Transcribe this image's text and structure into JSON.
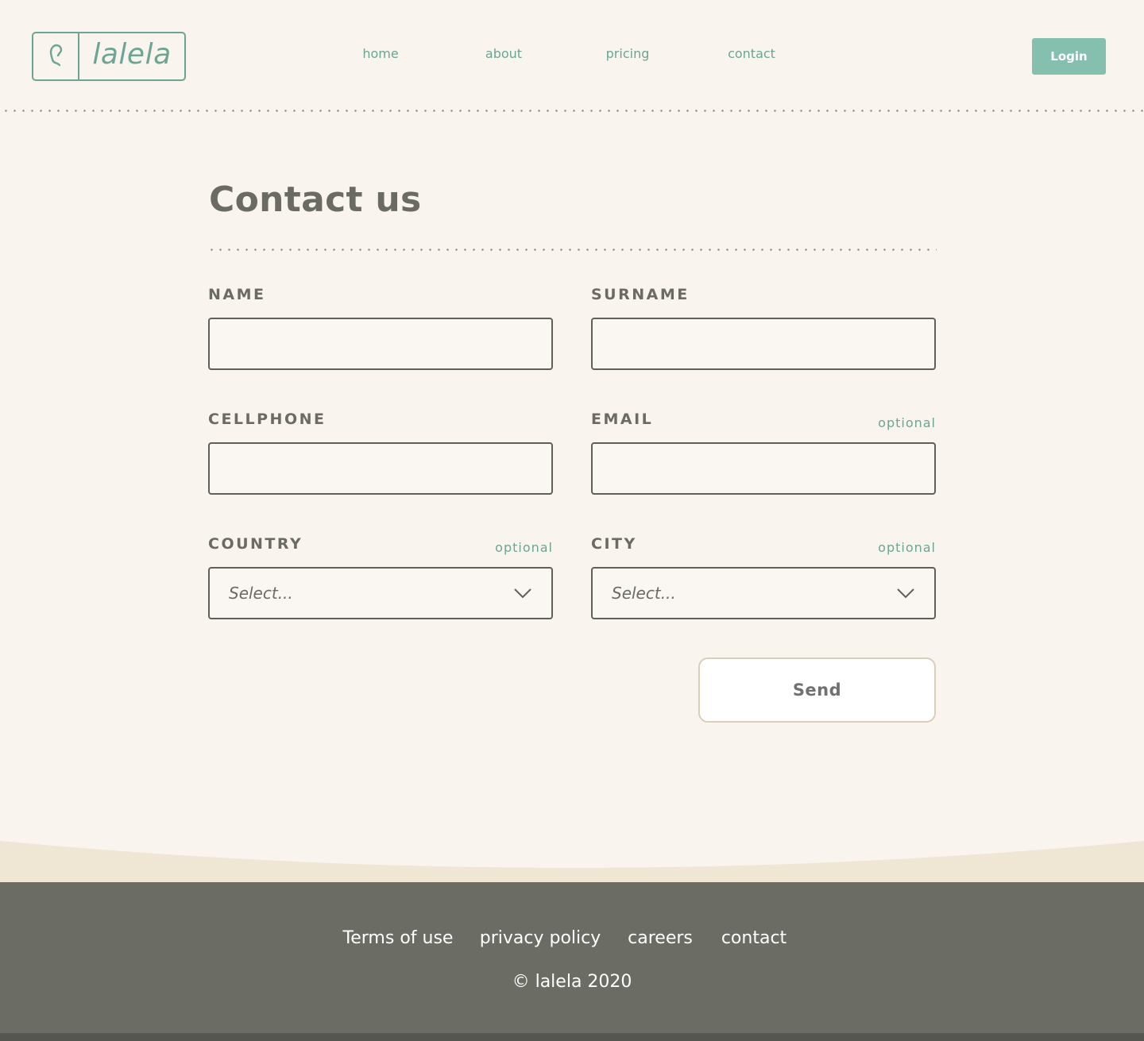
{
  "header": {
    "logo_text": "lalela",
    "nav": [
      "home",
      "about",
      "pricing",
      "contact"
    ],
    "login_label": "Login"
  },
  "form": {
    "title": "Contact us",
    "fields": [
      {
        "label": "NAME",
        "optional": "",
        "value": ""
      },
      {
        "label": "SURNAME",
        "optional": "",
        "value": ""
      },
      {
        "label": "CELLPHONE",
        "optional": "",
        "value": ""
      },
      {
        "label": "EMAIL",
        "optional": "optional",
        "value": ""
      },
      {
        "label": "COUNTRY",
        "optional": "optional",
        "selected": "Select..."
      },
      {
        "label": "CITY",
        "optional": "optional",
        "selected": "Select..."
      }
    ],
    "send_label": "Send"
  },
  "footer": {
    "links": [
      "Terms of use",
      "privacy policy",
      "careers",
      "contact"
    ],
    "copyright": "© lalela 2020"
  },
  "colors": {
    "background": "#f9f5ee",
    "accent": "#6ca594",
    "login_button": "#85c0af",
    "text_dark": "#6a6b62",
    "footer": "#6b6c64",
    "wave": "#efe6d4"
  },
  "icons": {
    "logo_mark": "ear-icon",
    "select_arrow": "chevron-down-icon"
  }
}
